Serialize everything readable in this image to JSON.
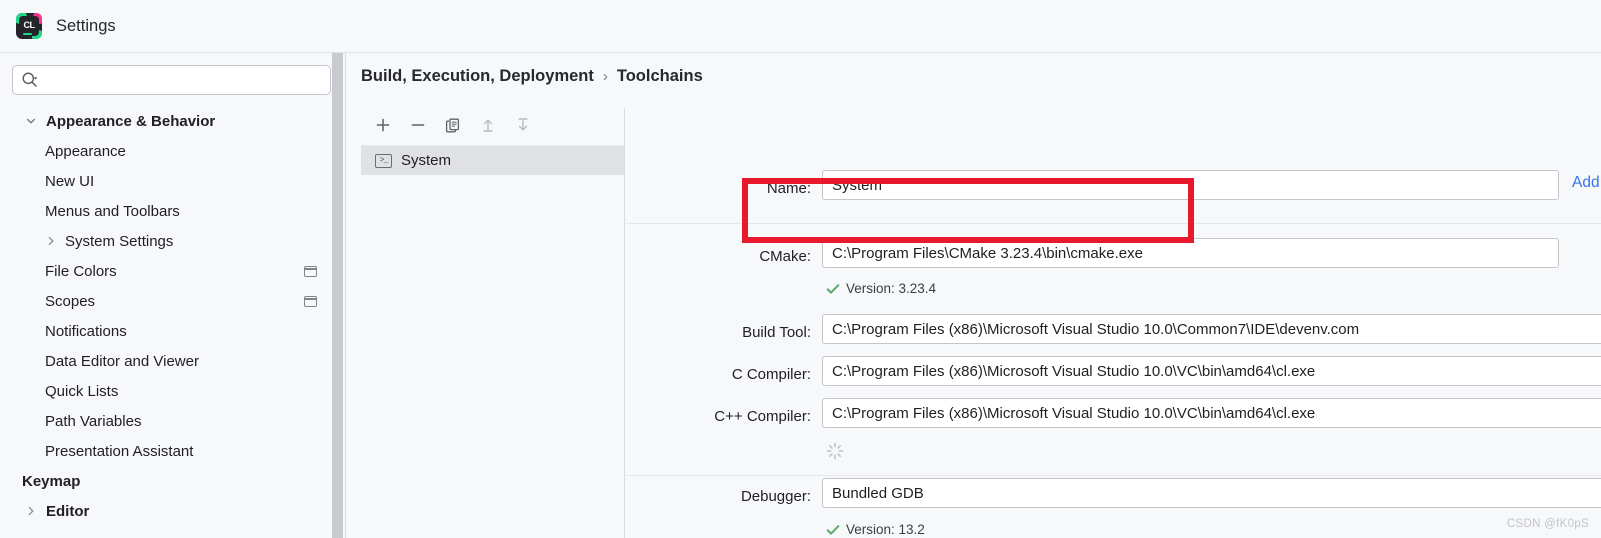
{
  "window": {
    "title": "Settings",
    "app_icon": "clion-icon",
    "icon_text": "CL"
  },
  "search": {
    "value": "",
    "placeholder": "",
    "icon": "search-icon"
  },
  "sidebar": {
    "items": [
      {
        "label": "Appearance & Behavior",
        "level": 0,
        "bold": true,
        "chevron": "down",
        "badge": false
      },
      {
        "label": "Appearance",
        "level": 1,
        "bold": false,
        "chevron": "none",
        "badge": false
      },
      {
        "label": "New UI",
        "level": 1,
        "bold": false,
        "chevron": "none",
        "badge": false
      },
      {
        "label": "Menus and Toolbars",
        "level": 1,
        "bold": false,
        "chevron": "none",
        "badge": false
      },
      {
        "label": "System Settings",
        "level": 1,
        "bold": false,
        "chevron": "right",
        "badge": false
      },
      {
        "label": "File Colors",
        "level": 1,
        "bold": false,
        "chevron": "none",
        "badge": true
      },
      {
        "label": "Scopes",
        "level": 1,
        "bold": false,
        "chevron": "none",
        "badge": true
      },
      {
        "label": "Notifications",
        "level": 1,
        "bold": false,
        "chevron": "none",
        "badge": false
      },
      {
        "label": "Data Editor and Viewer",
        "level": 1,
        "bold": false,
        "chevron": "none",
        "badge": false
      },
      {
        "label": "Quick Lists",
        "level": 1,
        "bold": false,
        "chevron": "none",
        "badge": false
      },
      {
        "label": "Path Variables",
        "level": 1,
        "bold": false,
        "chevron": "none",
        "badge": false
      },
      {
        "label": "Presentation Assistant",
        "level": 1,
        "bold": false,
        "chevron": "none",
        "badge": false
      },
      {
        "label": "Keymap",
        "level": 0,
        "bold": true,
        "chevron": "none",
        "badge": false
      },
      {
        "label": "Editor",
        "level": 0,
        "bold": true,
        "chevron": "right",
        "badge": false
      }
    ]
  },
  "breadcrumb": {
    "parent": "Build, Execution, Deployment",
    "separator": "›",
    "current": "Toolchains"
  },
  "toolchain_list": {
    "toolbar": [
      {
        "name": "add-toolchain-button",
        "glyph": "plus",
        "enabled": true
      },
      {
        "name": "remove-toolchain-button",
        "glyph": "minus",
        "enabled": true
      },
      {
        "name": "copy-toolchain-button",
        "glyph": "copy",
        "enabled": true
      },
      {
        "name": "move-up-button",
        "glyph": "arrow-up",
        "enabled": false
      },
      {
        "name": "move-down-button",
        "glyph": "arrow-down",
        "enabled": false
      }
    ],
    "items": [
      {
        "label": "System",
        "icon": "terminal-icon",
        "selected": true
      }
    ]
  },
  "detail": {
    "fields": [
      {
        "key": "name",
        "label": "Name:",
        "value": "System"
      },
      {
        "key": "cmake",
        "label": "CMake:",
        "value": "C:\\Program Files\\CMake 3.23.4\\bin\\cmake.exe"
      },
      {
        "key": "build_tool",
        "label": "Build Tool:",
        "value": "C:\\Program Files (x86)\\Microsoft Visual Studio 10.0\\Common7\\IDE\\devenv.com"
      },
      {
        "key": "c_compiler",
        "label": "C Compiler:",
        "value": "C:\\Program Files (x86)\\Microsoft Visual Studio 10.0\\VC\\bin\\amd64\\cl.exe"
      },
      {
        "key": "cpp_compiler",
        "label": "C++ Compiler:",
        "value": "C:\\Program Files (x86)\\Microsoft Visual Studio 10.0\\VC\\bin\\amd64\\cl.exe"
      },
      {
        "key": "debugger",
        "label": "Debugger:",
        "value": "Bundled GDB"
      }
    ],
    "cmake_status": "Version: 3.23.4",
    "debugger_status": "Version: 13.2",
    "add_environment_link": "Add e",
    "status_icon": "check-icon",
    "loading_icon": "spinner-icon"
  },
  "annotation": {
    "shape": "rectangle",
    "color": "#e8192c",
    "targets": "cmake-field"
  },
  "watermark": "CSDN @fK0pS",
  "colors": {
    "background": "#f7f8fa",
    "field_bg": "#ffffff",
    "field_border": "#c4c6cc",
    "selection": "#dfe1e5",
    "link": "#3574f0",
    "success": "#59a869",
    "annotation_red": "#e8192c"
  }
}
